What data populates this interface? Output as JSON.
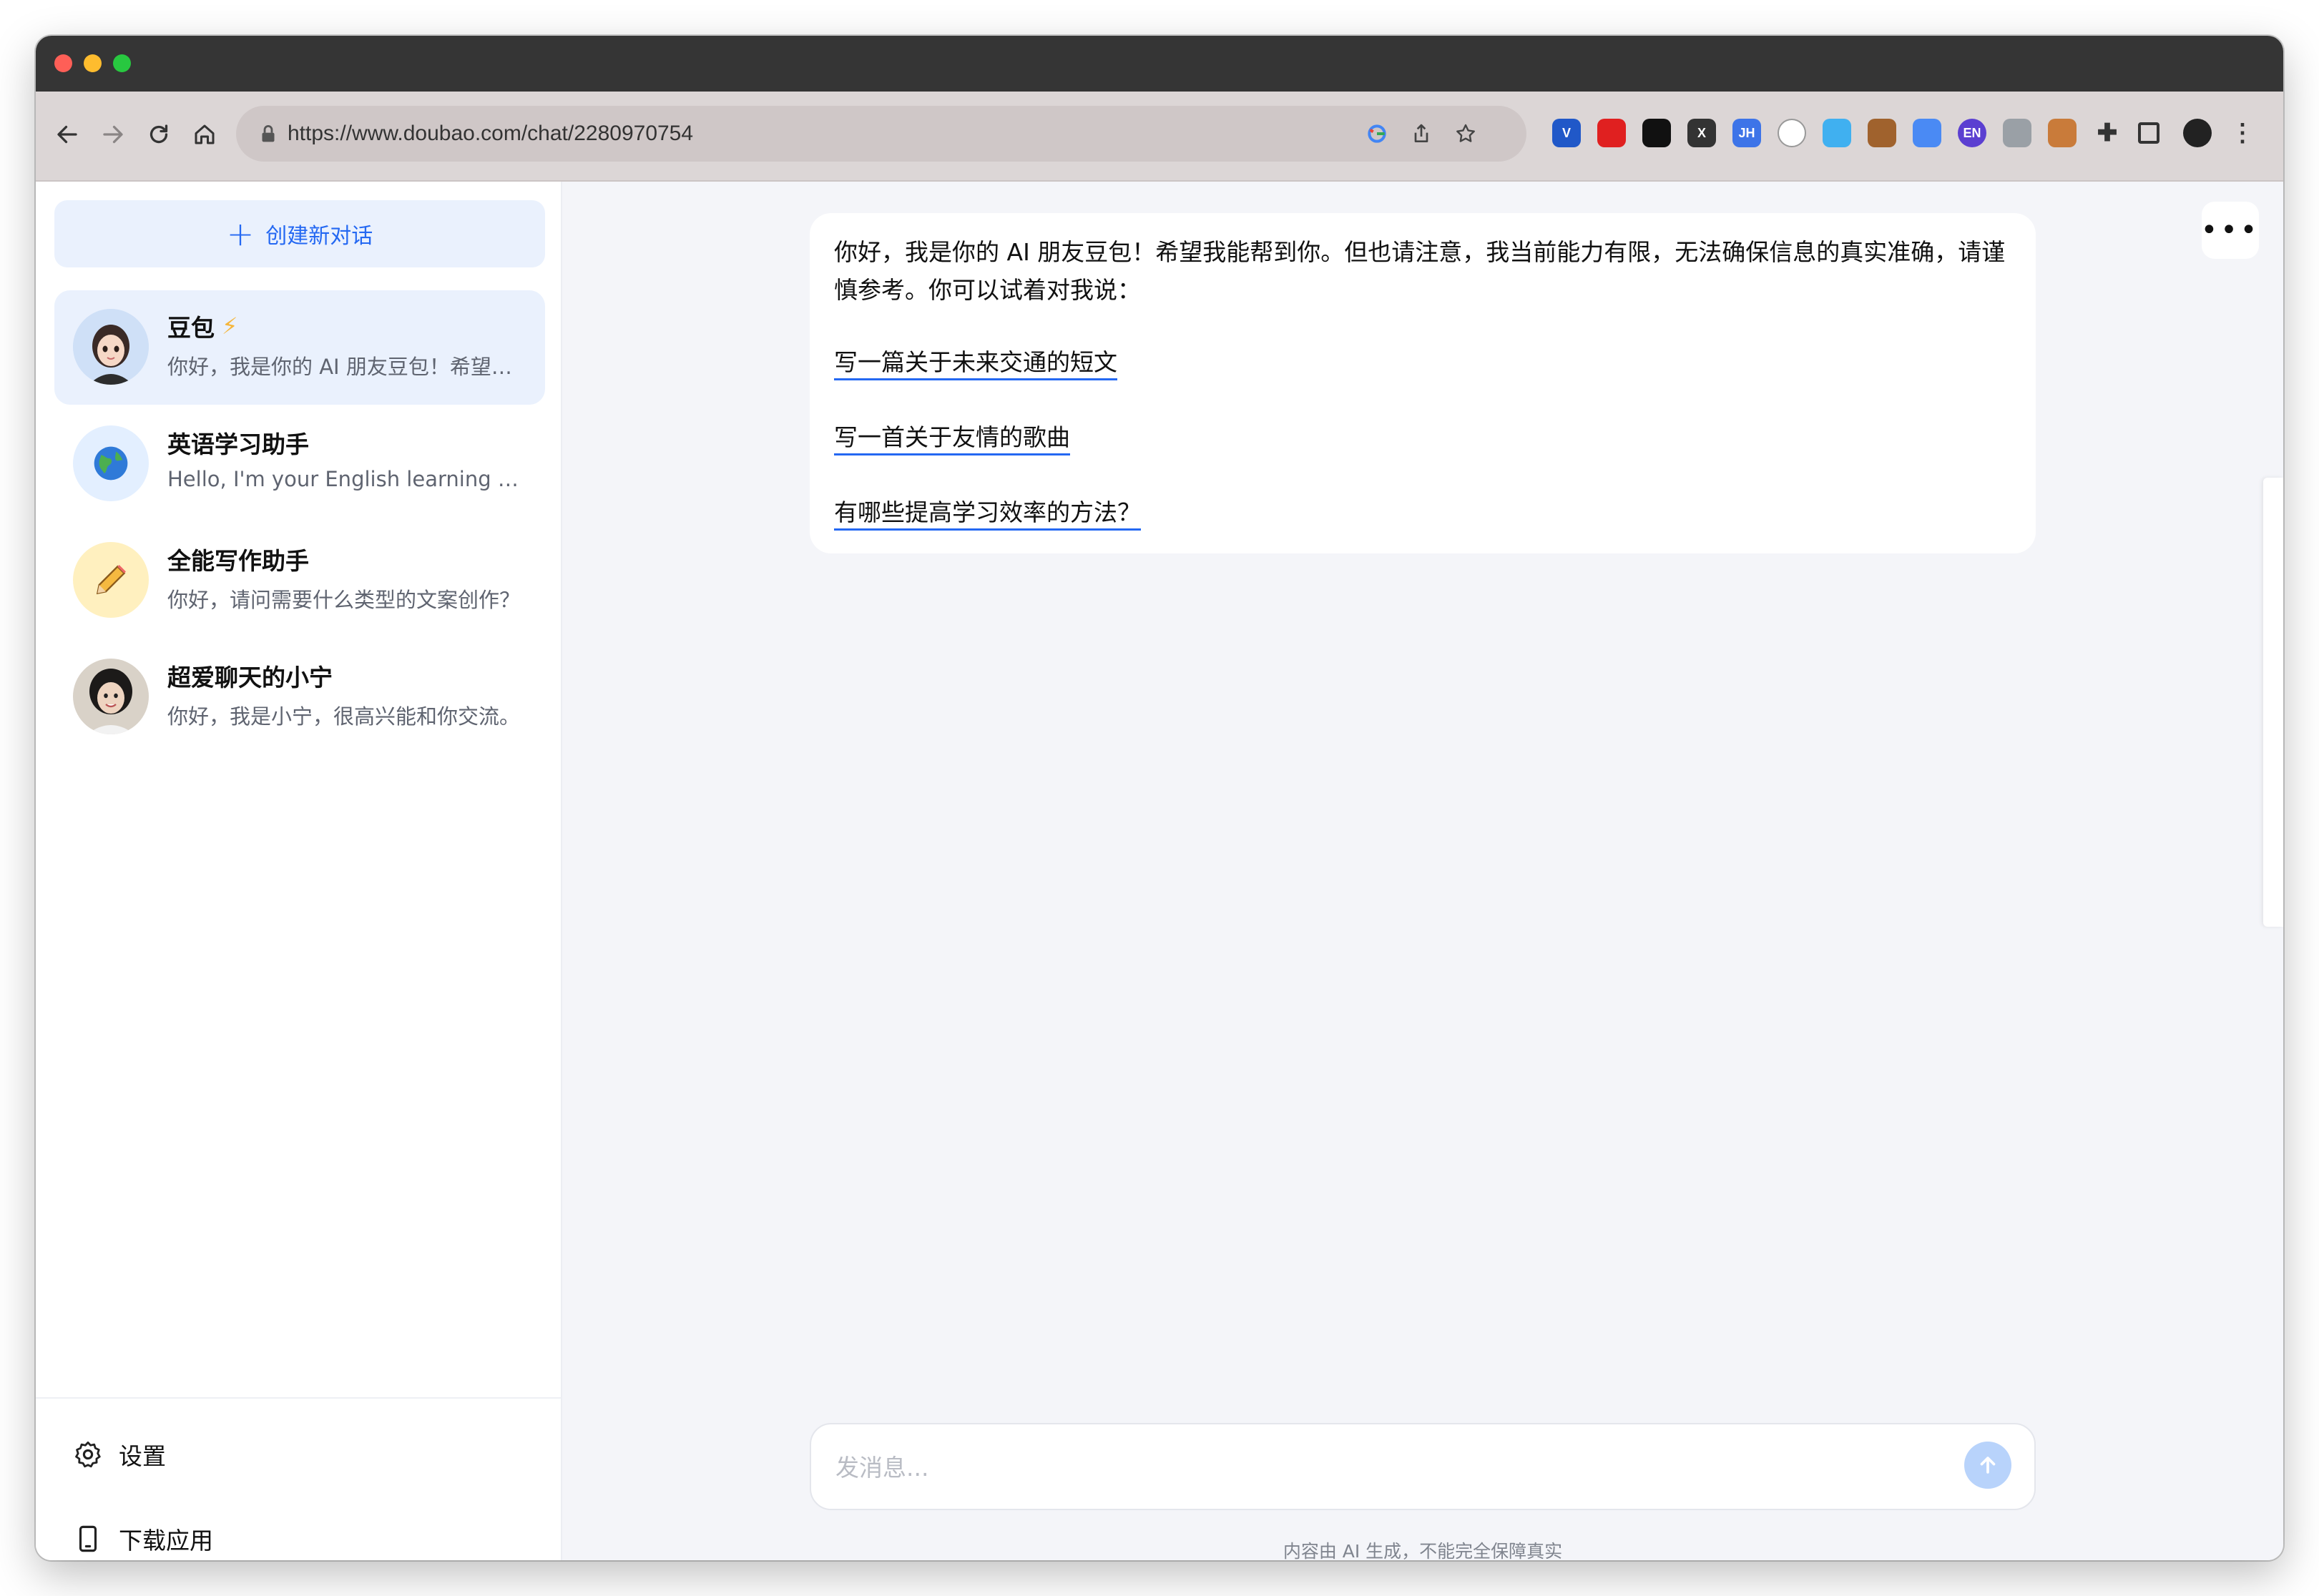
{
  "browser": {
    "url": "https://www.doubao.com/chat/2280970754",
    "extensions": [
      {
        "name": "v-extension-icon",
        "label": "V",
        "color": "#2058c8"
      },
      {
        "name": "adblock-icon",
        "label": "",
        "color": "#e02020"
      },
      {
        "name": "tampermonkey-icon",
        "label": "",
        "color": "#111111"
      },
      {
        "name": "x-extension-icon",
        "label": "X",
        "color": "#333333"
      },
      {
        "name": "jh-extension-icon",
        "label": "JH",
        "color": "#3d74e8"
      },
      {
        "name": "cat-extension-icon",
        "label": "",
        "color": "#ffffff"
      },
      {
        "name": "shield-extension-icon",
        "label": "",
        "color": "#40b0f0"
      },
      {
        "name": "cookie-extension-icon",
        "label": "",
        "color": "#a0622d"
      },
      {
        "name": "translate-extension-icon",
        "label": "",
        "color": "#4a8af4"
      },
      {
        "name": "en-extension-icon",
        "label": "EN",
        "color": "#5b3fd1"
      },
      {
        "name": "chart-extension-icon",
        "label": "",
        "color": "#9aa0a6"
      },
      {
        "name": "monkey-extension-icon",
        "label": "",
        "color": "#c97b3a"
      },
      {
        "name": "puzzle-icon",
        "label": "",
        "color": "#333333"
      },
      {
        "name": "sidepanel-icon",
        "label": "",
        "color": "#333333"
      },
      {
        "name": "profile-avatar-icon",
        "label": "",
        "color": "#222222"
      },
      {
        "name": "kebab-menu-icon",
        "label": "",
        "color": "#333333"
      }
    ]
  },
  "sidebar": {
    "new_chat_label": "创建新对话",
    "chats": [
      {
        "name": "豆包",
        "preview": "你好，我是你的 AI 朋友豆包！希望我能帮到你。",
        "bolt": "⚡",
        "active": true
      },
      {
        "name": "英语学习助手",
        "preview": "Hello, I'm your English learning assistant.",
        "active": false
      },
      {
        "name": "全能写作助手",
        "preview": "你好，请问需要什么类型的文案创作？",
        "active": false
      },
      {
        "name": "超爱聊天的小宁",
        "preview": "你好，我是小宁，很高兴能和你交流。",
        "active": false
      }
    ],
    "settings_label": "设置",
    "download_label": "下载应用"
  },
  "conversation": {
    "intro": "你好，我是你的 AI 朋友豆包！希望我能帮到你。但也请注意，我当前能力有限，无法确保信息的真实准确，请谨慎参考。你可以试着对我说：",
    "suggestions": [
      "写一篇关于未来交通的短文",
      "写一首关于友情的歌曲",
      "有哪些提高学习效率的方法？"
    ]
  },
  "composer": {
    "placeholder": "发消息...",
    "value": ""
  },
  "footer_note": "内容由 AI 生成，不能完全保障真实",
  "colors": {
    "accent": "#2468f2",
    "accent_light": "#eaf1fd",
    "send_disabled": "#b8d3fb"
  }
}
